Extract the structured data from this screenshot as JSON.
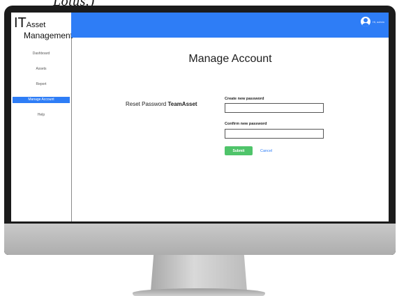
{
  "caption": {
    "text": "Lotus.)"
  },
  "app": {
    "logo_it": "IT",
    "logo_asset": "Asset",
    "logo_management": "Management"
  },
  "sidebar": {
    "items": [
      {
        "label": "Dashboard",
        "active": false
      },
      {
        "label": "Assets",
        "active": false
      },
      {
        "label": "Report",
        "active": false
      },
      {
        "label": "Manage Account",
        "active": true
      },
      {
        "label": "Help",
        "active": false
      }
    ]
  },
  "header": {
    "user_label": "Hi, admin",
    "accent_color": "#2e7df6"
  },
  "main": {
    "title": "Manage Account",
    "reset_prefix": "Reset Password",
    "reset_account": "TeamAsset",
    "new_password_label": "Create new password",
    "new_password_value": "",
    "confirm_password_label": "Confirm new password",
    "confirm_password_value": "",
    "submit_label": "Submit",
    "submit_color": "#4fc46a",
    "cancel_label": "Cancel"
  },
  "icons": {
    "user_avatar": "user-avatar-icon"
  }
}
